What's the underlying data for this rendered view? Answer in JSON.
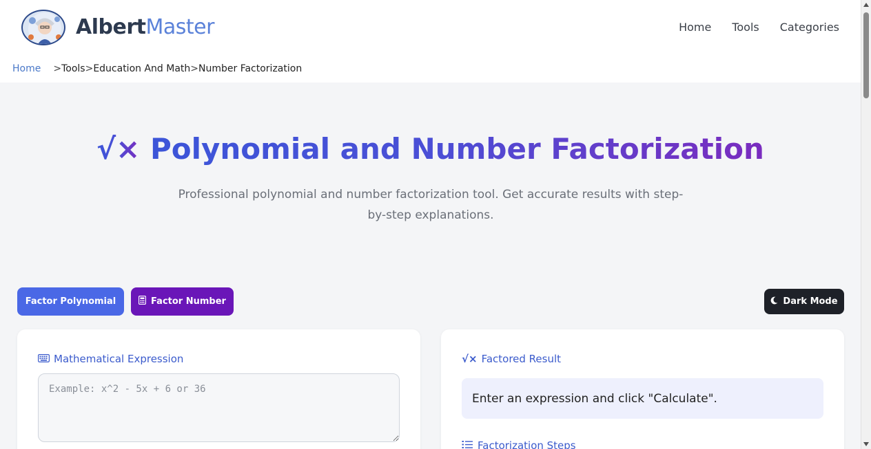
{
  "brand": {
    "name_part1": "Albert",
    "name_part2": "Master"
  },
  "nav": {
    "items": [
      "Home",
      "Tools",
      "Categories"
    ]
  },
  "breadcrumb": {
    "home": "Home",
    "separator": ">",
    "items": [
      "Tools",
      "Education And Math",
      "Number Factorization"
    ]
  },
  "hero": {
    "icon": "√×",
    "title": "Polynomial and Number Factorization",
    "subtitle": "Professional polynomial and number factorization tool. Get accurate results with step-by-step explanations."
  },
  "mode_buttons": {
    "factor_polynomial": "Factor Polynomial",
    "factor_number": "Factor Number",
    "dark_mode": "Dark Mode"
  },
  "input_card": {
    "label": "Mathematical Expression",
    "placeholder": "Example: x^2 - 5x + 6 or 36",
    "value": ""
  },
  "result_card": {
    "label": "Factored Result",
    "result_text": "Enter an expression and click \"Calculate\".",
    "steps_label": "Factorization Steps"
  },
  "colors": {
    "accent_blue": "#4a68e6",
    "accent_purple": "#6a16b8",
    "dark_button": "#1e2128",
    "label_blue": "#3b5bcc"
  }
}
